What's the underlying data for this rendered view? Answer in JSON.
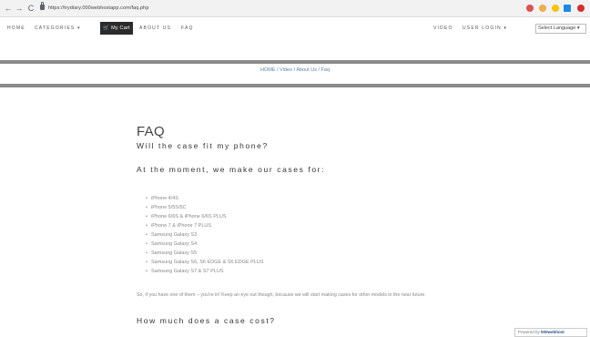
{
  "browser": {
    "back": "←",
    "forward": "→",
    "reload": "C",
    "url": "https://trydiary.000webhostapp.com/faq.php",
    "extension_colors": [
      "#d9534f",
      "#f0ad4e",
      "#f5c400",
      "#1e88e5",
      "#d32f2f"
    ]
  },
  "nav": {
    "home": "HOME",
    "categories": "CATEGORIES ▾",
    "cart": "My Cart",
    "about": "ABOUT US",
    "faq": "FAQ",
    "video": "VIDEO",
    "user_login": "USER LOGIN ▾",
    "translate": "Select Language ▾"
  },
  "breadcrumb": "HOME / Video / About Us / Faq",
  "content": {
    "title": "FAQ",
    "q1": "Will the case fit my phone?",
    "answer_intro": "At the moment, we make our cases for:",
    "phones": [
      "iPhone 4/4S",
      "iPhone 5/5S/5C",
      "iPhone 6/6S & iPhone 6/6S PLUS",
      "iPhone 7 & iPhone 7 PLUS",
      "Samsung Galaxy S3",
      "Samsung Galaxy S4",
      "Samsung Galaxy S5",
      "Samsung Galaxy S6, S6 EDGE & S6 EDGE PLUS",
      "Samsung Galaxy S7 & S7 PLUS"
    ],
    "note": "So, if you have one of them – you're in! Keep an eye out though, because we will start making cases for other models in the near future.",
    "q2": "How much does a case cost?"
  },
  "powered_by": {
    "prefix": "Powered by",
    "brand": "000webhost"
  }
}
